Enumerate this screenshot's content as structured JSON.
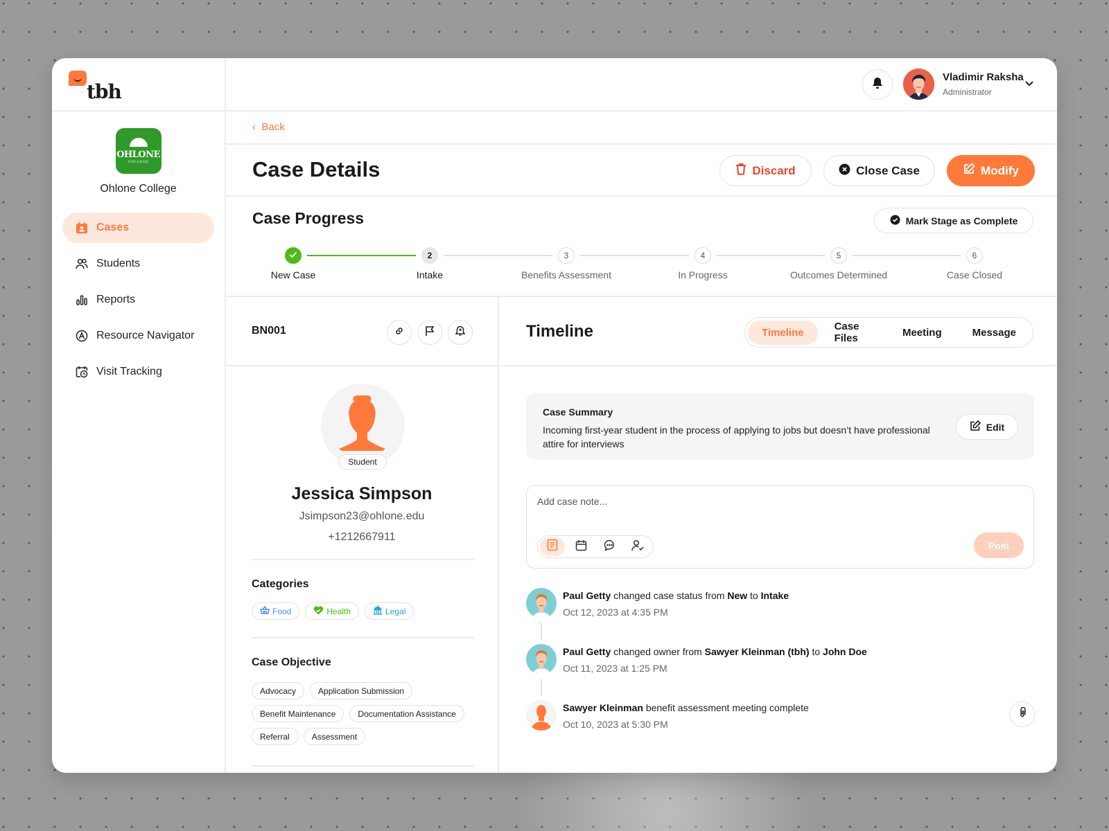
{
  "brand": {
    "name": "tbh",
    "accent": "#ff7a3a"
  },
  "sidebar": {
    "org_name": "Ohlone College",
    "org_logo_text": "OHLONE",
    "org_logo_sub": "COLLEGE",
    "items": [
      {
        "label": "Cases",
        "icon": "cases-icon",
        "active": true
      },
      {
        "label": "Students",
        "icon": "users-icon"
      },
      {
        "label": "Reports",
        "icon": "bar-chart-icon"
      },
      {
        "label": "Resource Navigator",
        "icon": "navigator-icon"
      },
      {
        "label": "Visit Tracking",
        "icon": "calendar-clock-icon"
      }
    ]
  },
  "header": {
    "user_name": "Vladimir Raksha",
    "user_role": "Administrator"
  },
  "page": {
    "back_label": "Back",
    "title": "Case Details",
    "actions": {
      "discard": "Discard",
      "close_case": "Close Case",
      "modify": "Modify"
    }
  },
  "progress": {
    "title": "Case Progress",
    "mark_complete_label": "Mark Stage as Complete",
    "current_step": 2,
    "steps": [
      {
        "num": "1",
        "label": "New Case",
        "state": "done"
      },
      {
        "num": "2",
        "label": "Intake",
        "state": "current"
      },
      {
        "num": "3",
        "label": "Benefits Assessment",
        "state": "pending"
      },
      {
        "num": "4",
        "label": "In Progress",
        "state": "pending"
      },
      {
        "num": "5",
        "label": "Outcomes Determined",
        "state": "pending"
      },
      {
        "num": "6",
        "label": "Case Closed",
        "state": "pending"
      }
    ]
  },
  "case": {
    "id": "BN001",
    "student": {
      "badge": "Student",
      "name": "Jessica Simpson",
      "email": "Jsimpson23@ohlone.edu",
      "phone": "+1212667911"
    },
    "categories_title": "Categories",
    "categories": [
      {
        "label": "Food",
        "color": "#4a8df6"
      },
      {
        "label": "Health",
        "color": "#4cbb17"
      },
      {
        "label": "Legal",
        "color": "#22a8d8"
      }
    ],
    "objective_title": "Case Objective",
    "objectives": [
      "Advocacy",
      "Application Submission",
      "Benefit Maintenance",
      "Documentation Assistance",
      "Referral",
      "Assessment"
    ]
  },
  "timeline": {
    "title": "Timeline",
    "tabs": [
      "Timeline",
      "Case Files",
      "Meeting",
      "Message"
    ],
    "active_tab": "Timeline",
    "summary": {
      "title": "Case Summary",
      "text": "Incoming first-year student in the process of applying to jobs but doesn’t have professional attire for interviews",
      "edit_label": "Edit"
    },
    "note": {
      "placeholder": "Add case note...",
      "post_label": "Post"
    },
    "events": [
      {
        "actor": "Paul Getty",
        "parts": [
          " changed case status from ",
          "New",
          " to ",
          "Intake"
        ],
        "date": "Oct 12, 2023 at 4:35 PM"
      },
      {
        "actor": "Paul Getty",
        "parts": [
          " changed owner from ",
          "Sawyer Kleinman (tbh)",
          " to ",
          "John Doe"
        ],
        "date": "Oct 11, 2023 at 1:25 PM"
      },
      {
        "actor": "Sawyer Kleinman",
        "parts": [
          " benefit assessment meeting complete"
        ],
        "date": "Oct 10, 2023 at 5:30 PM",
        "attachment": true
      }
    ]
  }
}
